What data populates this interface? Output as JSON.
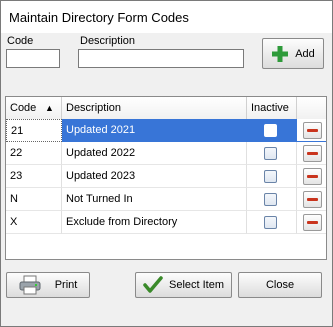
{
  "window": {
    "title": "Maintain Directory Form Codes"
  },
  "form": {
    "code_label": "Code",
    "description_label": "Description",
    "code_value": "",
    "description_value": "",
    "add_label": "Add"
  },
  "table": {
    "columns": [
      "Code",
      "Description",
      "Inactive",
      ""
    ],
    "selected_index": 0,
    "rows": [
      {
        "code": "21",
        "description": "Updated 2021",
        "inactive": false
      },
      {
        "code": "22",
        "description": "Updated 2022",
        "inactive": false
      },
      {
        "code": "23",
        "description": "Updated 2023",
        "inactive": false
      },
      {
        "code": "N",
        "description": "Not Turned In",
        "inactive": false
      },
      {
        "code": "X",
        "description": "Exclude from Directory",
        "inactive": false
      }
    ]
  },
  "buttons": {
    "print_label": "Print",
    "select_label": "Select Item",
    "close_label": "Close"
  },
  "colors": {
    "selection": "#3875d7",
    "add_icon": "#2e9a3a",
    "delete_icon": "#c9341d",
    "check_icon": "#3a8a2a"
  },
  "icons": {
    "add": "plus-icon",
    "delete": "minus-icon",
    "print": "printer-icon",
    "select": "checkmark-icon"
  }
}
